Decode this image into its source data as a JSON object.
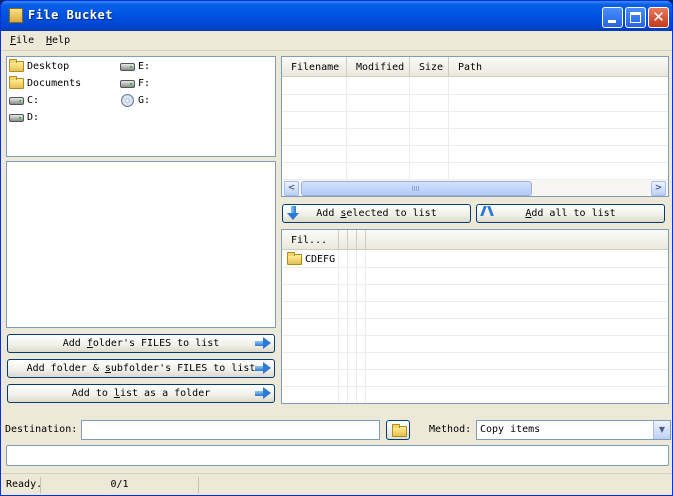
{
  "window": {
    "title": "File Bucket"
  },
  "menu": [
    {
      "label": "File",
      "accel": "F",
      "rest": "ile"
    },
    {
      "label": "Help",
      "accel": "H",
      "rest": "elp"
    }
  ],
  "drives": [
    {
      "label": "Desktop",
      "icon": "folder-icon"
    },
    {
      "label": "Documents",
      "icon": "folder-icon"
    },
    {
      "label": "C:",
      "icon": "hard-drive-icon"
    },
    {
      "label": "D:",
      "icon": "hard-drive-icon"
    },
    {
      "label": "E:",
      "icon": "hard-drive-icon"
    },
    {
      "label": "F:",
      "icon": "hard-drive-icon"
    },
    {
      "label": "G:",
      "icon": "cd-drive-icon"
    }
  ],
  "left_buttons": {
    "add_folder_files": {
      "pre": "Add ",
      "accel": "f",
      "post": "older's FILES to list"
    },
    "add_folder_subfolder": {
      "pre": "Add folder & ",
      "accel": "s",
      "post": "ubfolder's FILES to list"
    },
    "add_as_folder": {
      "pre": "Add to ",
      "accel": "l",
      "post": "ist as a folder"
    }
  },
  "list_grid": {
    "columns": [
      "Filename",
      "Modified",
      "Size",
      "Path"
    ]
  },
  "middle_buttons": {
    "add_selected": {
      "pre": "Add ",
      "accel": "s",
      "post": "elected to list"
    },
    "add_all": {
      "pre": "",
      "accel": "A",
      "post": "dd all to list"
    }
  },
  "files_grid": {
    "column": "Fil...",
    "items": [
      {
        "label": "CDEFG",
        "icon": "folder-icon"
      }
    ]
  },
  "destination": {
    "label": "Destination:",
    "value": ""
  },
  "method": {
    "label": "Method:",
    "value": "Copy items"
  },
  "status": {
    "text": "Ready.",
    "count": "0/1"
  }
}
